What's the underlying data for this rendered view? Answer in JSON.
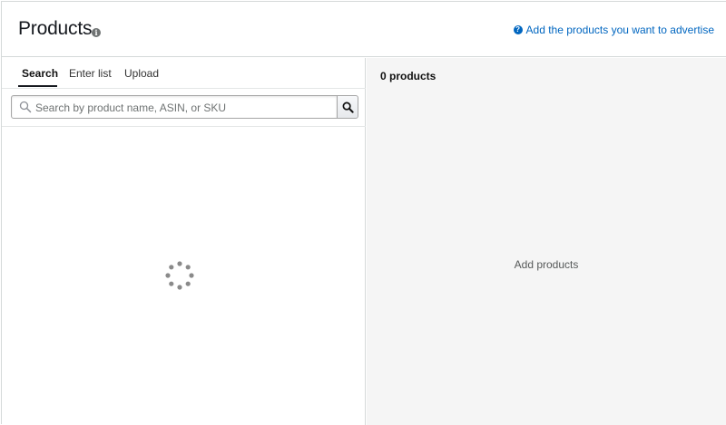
{
  "header": {
    "title": "Products",
    "help_link": "Add the products you want to advertise"
  },
  "tabs": [
    {
      "label": "Search",
      "active": true
    },
    {
      "label": "Enter list",
      "active": false
    },
    {
      "label": "Upload",
      "active": false
    }
  ],
  "search": {
    "placeholder": "Search by product name, ASIN, or SKU",
    "value": ""
  },
  "results": {
    "count_label": "0 products",
    "empty_label": "Add products"
  },
  "colors": {
    "link": "#0066c0",
    "border": "#d5d9d9",
    "panel_bg": "#f5f5f5"
  }
}
